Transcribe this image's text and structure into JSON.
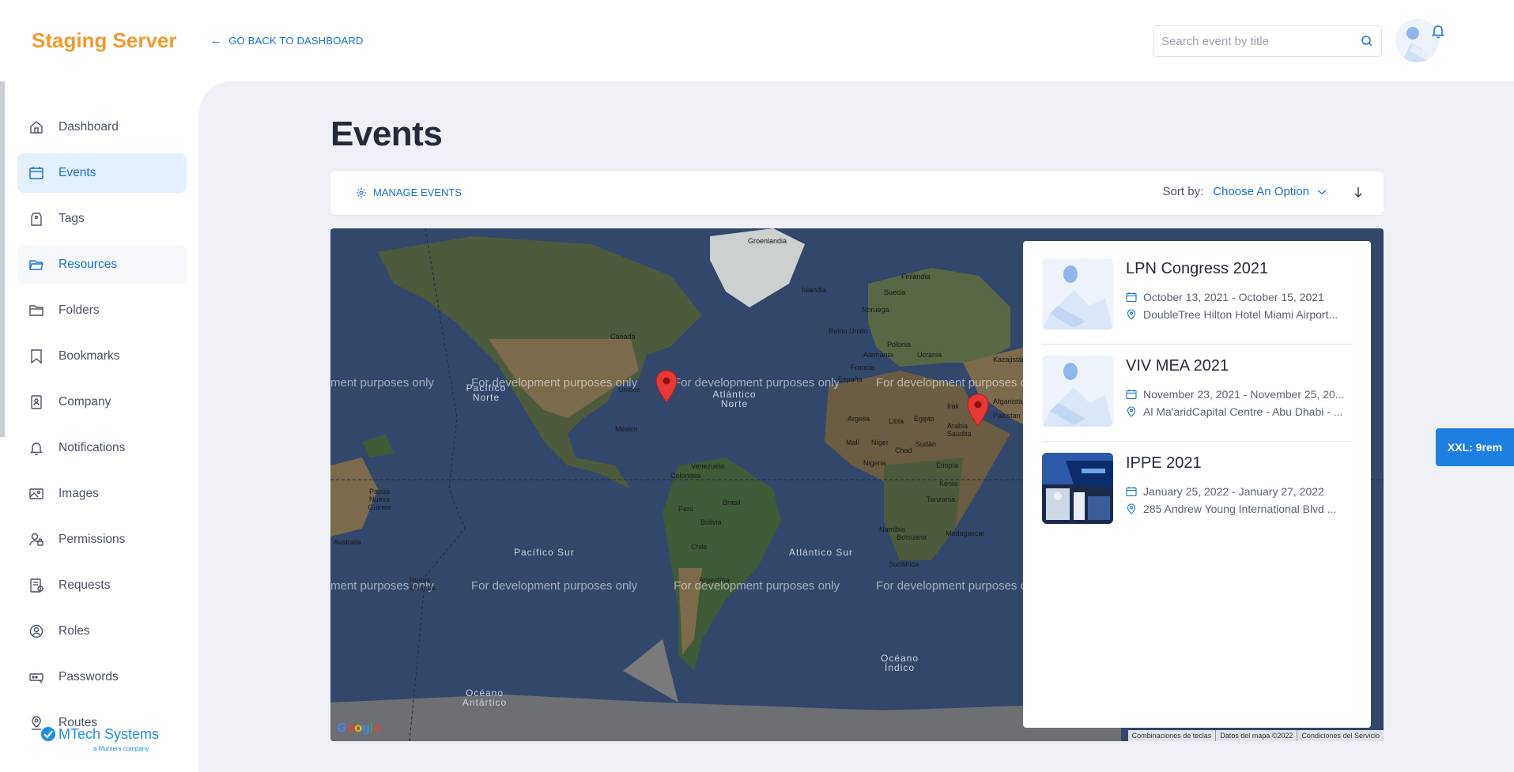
{
  "header": {
    "brand": "Staging Server",
    "back_link": "GO BACK TO DASHBOARD",
    "search_placeholder": "Search event by title"
  },
  "sidebar": {
    "items": [
      {
        "label": "Dashboard",
        "icon": "home-icon"
      },
      {
        "label": "Events",
        "icon": "calendar-icon",
        "state": "active"
      },
      {
        "label": "Tags",
        "icon": "tag-icon"
      },
      {
        "label": "Resources",
        "icon": "folder-open-icon",
        "state": "hover"
      },
      {
        "label": "Folders",
        "icon": "folder-icon"
      },
      {
        "label": "Bookmarks",
        "icon": "bookmark-icon"
      },
      {
        "label": "Company",
        "icon": "company-icon"
      },
      {
        "label": "Notifications",
        "icon": "bell-icon"
      },
      {
        "label": "Images",
        "icon": "image-icon"
      },
      {
        "label": "Permissions",
        "icon": "user-lock-icon"
      },
      {
        "label": "Requests",
        "icon": "requests-icon"
      },
      {
        "label": "Roles",
        "icon": "roles-icon"
      },
      {
        "label": "Passwords",
        "icon": "password-icon"
      },
      {
        "label": "Routes",
        "icon": "route-icon"
      }
    ],
    "logo_name": "MTech Systems",
    "logo_sub": "a Munters company"
  },
  "main": {
    "title": "Events",
    "manage_label": "MANAGE EVENTS",
    "sort_label": "Sort by:",
    "sort_value": "Choose An Option"
  },
  "map": {
    "dev_text": "For development purposes only",
    "dev_text_partial": "ment purposes only",
    "dev_text_edge": "For development purposes o",
    "labels": {
      "groenlandia": "Groenlandia",
      "islandia": "Islandia",
      "finlandia": "Finlandia",
      "suecia": "Suecia",
      "noruega": "Noruega",
      "reino_unido": "Reino Unido",
      "polonia": "Polonia",
      "alemania": "Alemania",
      "ucrania": "Ucrania",
      "francia": "Francia",
      "espana": "España",
      "kazajistan": "Kazajistán",
      "canada": "Canadá",
      "estados_unidos": "Unidos",
      "mexico": "México",
      "venezuela": "Venezuela",
      "colombia": "Colombia",
      "peru": "Perú",
      "brasil": "Brasil",
      "bolivia": "Bolivia",
      "chile": "Chile",
      "argentina": "Argentina",
      "argelia": "Argelia",
      "libia": "Libia",
      "egipto": "Egipto",
      "irak": "Irak",
      "afganistan": "Afganistá",
      "pakistan": "Pakistan",
      "arabia": "Arabia Saudita",
      "mali": "Malí",
      "niger": "Níger",
      "chad": "Chad",
      "sudan": "Sudán",
      "nigeria": "Nigeria",
      "etiopia": "Etiopía",
      "kenia": "Kenia",
      "tanzania": "Tanzania",
      "namibia": "Namibia",
      "botsuana": "Botsuana",
      "madagascar": "Madagascar",
      "sudafrica": "Sudáfrica",
      "australia": "Australia",
      "papua": "Papúa Nueva Guinea",
      "nueva_zelanda": "Nueva Zelanda",
      "pacifico_norte": "Pacífico Norte",
      "atlantico_norte": "Atlántico Norte",
      "pacifico_sur": "Pacífico Sur",
      "atlantico_sur": "Atlántico Sur",
      "oceano_indico": "Océano Índico",
      "oceano_antartico": "Océano Antártico"
    },
    "attribution": [
      "Combinaciones de teclas",
      "Datos del mapa ©2022",
      "Condiciones del Servicio"
    ],
    "google": "Google"
  },
  "events": [
    {
      "title": "LPN Congress 2021",
      "date": "October 13, 2021 - October 15, 2021",
      "location": "DoubleTree Hilton Hotel Miami Airport..."
    },
    {
      "title": "VIV MEA 2021",
      "date": "November 23, 2021 - November 25, 20...",
      "location": "Al Ma'aridCapital Centre - Abu Dhabi - ..."
    },
    {
      "title": "IPPE 2021",
      "date": "January 25, 2022 - January 27, 2022",
      "location": "285 Andrew Young International Blvd ..."
    }
  ],
  "badge": "XXL: 9rem",
  "colors": {
    "brand": "#f29a2e",
    "accent": "#1d6fc9",
    "map_ocean": "#33476a",
    "pin": "#e53935"
  }
}
